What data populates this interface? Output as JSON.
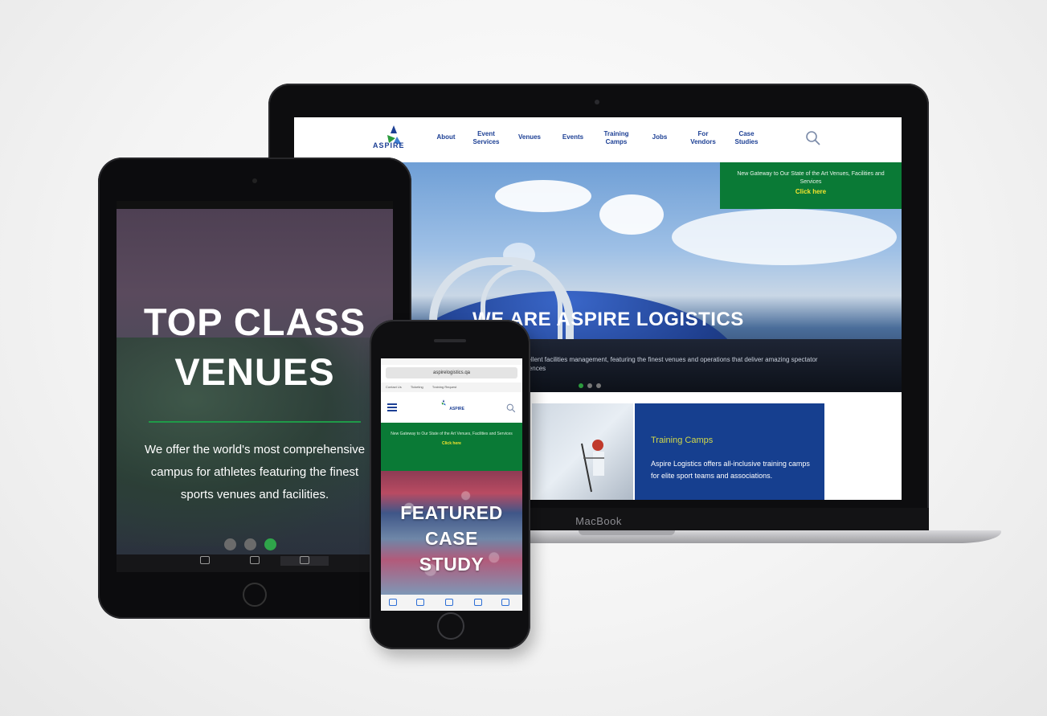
{
  "laptop": {
    "brand_label": "MacBook",
    "site": {
      "logo_text": "ASPIRE",
      "nav": [
        "About",
        "Event\nServices",
        "Venues",
        "Events",
        "Training\nCamps",
        "Jobs",
        "For\nVendors",
        "Case\nStudies"
      ],
      "promo": {
        "message": "New Gateway to Our State of the Art Venues, Facilities and Services",
        "cta": "Click here"
      },
      "hero": {
        "title": "WE ARE ASPIRE LOGISTICS",
        "subtitle": "…excellent facilities management, featuring the finest venues and operations that deliver amazing spectator experiences"
      },
      "card": {
        "title": "Training Camps",
        "body": "Aspire Logistics offers all-inclusive training camps for elite sport teams and associations."
      }
    }
  },
  "tablet": {
    "headline": "TOP CLASS VENUES",
    "headline_lines": [
      "TOP CLASS",
      "VENUES"
    ],
    "copy": "We offer the world's most comprehensive campus for athletes featuring the finest sports venues and facilities.",
    "dots_active": 3
  },
  "phone": {
    "url": "aspirelogistics.qa",
    "tabs": [
      "Contact Us",
      "Ticketing",
      "Training Request"
    ],
    "logo_text": "ASPIRE",
    "promo": {
      "message": "New Gateway to Our State of the Art Venues, Facilities and Services",
      "cta": "Click here"
    },
    "feature_lines": [
      "FEATURED",
      "CASE",
      "STUDY"
    ]
  },
  "colors": {
    "brand_blue": "#1c3f94",
    "promo_green": "#0a7a36",
    "accent_yellow": "#f3e42e",
    "dot_green": "#2fa54a"
  },
  "icons": [
    "search-icon",
    "menu-icon",
    "aspire-logo-icon"
  ]
}
